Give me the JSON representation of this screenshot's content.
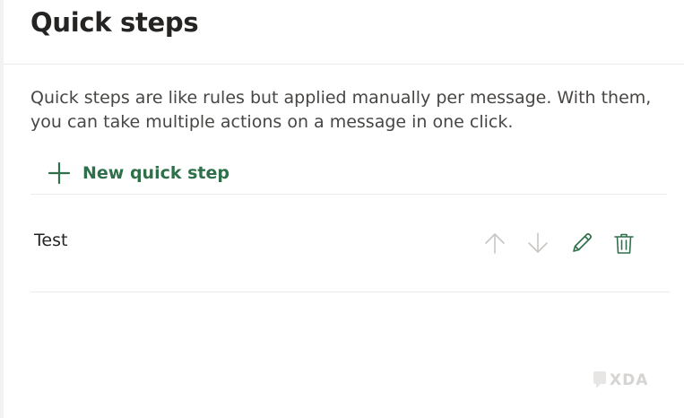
{
  "panel": {
    "title": "Quick steps",
    "description": "Quick steps are like rules but applied manually per message. With them, you can take multiple actions on a message in one click.",
    "new_quick_step_label": "New quick step"
  },
  "quick_steps": [
    {
      "name": "Test"
    }
  ],
  "icons": {
    "new": "plus-icon",
    "move_up": "arrow-up-icon",
    "move_down": "arrow-down-icon",
    "edit": "pencil-icon",
    "delete": "trash-icon",
    "watermark": "xda-logo-icon"
  },
  "colors": {
    "accent": "#2f6f4a",
    "disabled": "#c8c6c4",
    "text": "#323130"
  },
  "watermark": "XDA"
}
